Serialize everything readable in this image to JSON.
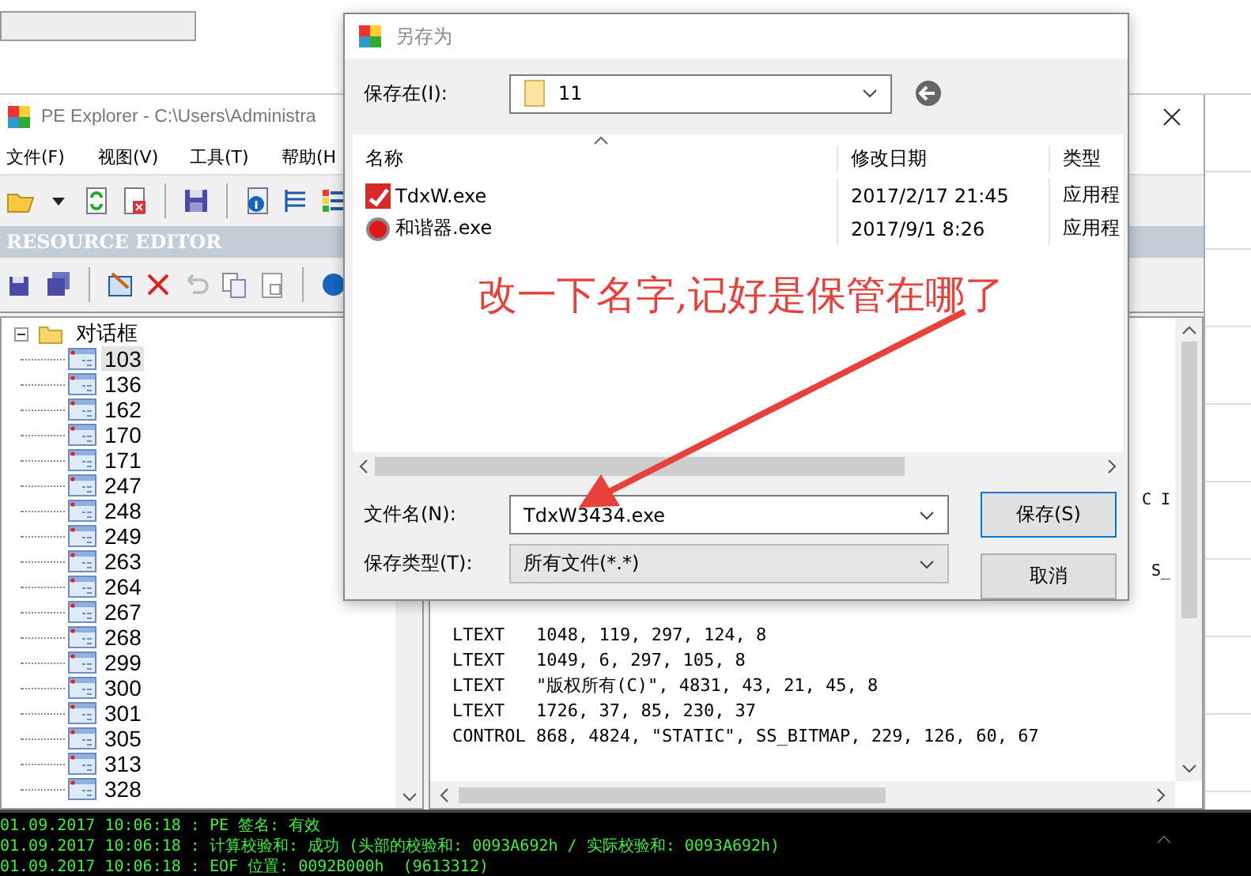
{
  "main_window": {
    "title": "PE Explorer - C:\\Users\\Administra",
    "menu": [
      "文件(F)",
      "视图(V)",
      "工具(T)",
      "帮助(H"
    ],
    "panel_title": "RESOURCE EDITOR",
    "tree": {
      "label": "对话框",
      "expanded": true,
      "children": [
        {
          "label": "103",
          "selected": true
        },
        {
          "label": "136",
          "selected": false
        },
        {
          "label": "162",
          "selected": false
        },
        {
          "label": "170",
          "selected": false
        },
        {
          "label": "171",
          "selected": false
        },
        {
          "label": "247",
          "selected": false
        },
        {
          "label": "248",
          "selected": false
        },
        {
          "label": "249",
          "selected": false
        },
        {
          "label": "263",
          "selected": false
        },
        {
          "label": "264",
          "selected": false
        },
        {
          "label": "267",
          "selected": false
        },
        {
          "label": "268",
          "selected": false
        },
        {
          "label": "299",
          "selected": false
        },
        {
          "label": "300",
          "selected": false
        },
        {
          "label": "301",
          "selected": false
        },
        {
          "label": "305",
          "selected": false
        },
        {
          "label": "313",
          "selected": false
        },
        {
          "label": "328",
          "selected": false
        }
      ]
    },
    "code_lines": [
      "LTEXT   1048, 119, 297, 124, 8",
      "LTEXT   1049, 6, 297, 105, 8",
      "LTEXT   \"版权所有(C)\", 4831, 43, 21, 45, 8",
      "LTEXT   1726, 37, 85, 230, 37",
      "CONTROL 868, 4824, \"STATIC\", SS_BITMAP, 229, 126, 60, 67"
    ],
    "code_fragments": [
      "C I",
      "S_"
    ],
    "log": [
      "01.09.2017 10:06:18 : PE 签名: 有效",
      "01.09.2017 10:06:18 : 计算校验和: 成功 (头部的校验和: 0093A692h / 实际校验和: 0093A692h)",
      "01.09.2017 10:06:18 : EOF 位置: 0092B000h  (9613312)"
    ]
  },
  "dialog": {
    "title": "另存为",
    "save_in_label": "保存在(I):",
    "folder": "11",
    "columns": [
      "名称",
      "修改日期",
      "类型"
    ],
    "files": [
      {
        "name": "TdxW.exe",
        "kind": "app",
        "date": "2017/2/17 21:45",
        "type": "应用程"
      },
      {
        "name": "和谐器.exe",
        "kind": "round",
        "date": "2017/9/1 8:26",
        "type": "应用程"
      }
    ],
    "filename_label": "文件名(N):",
    "filename": "TdxW3434.exe",
    "filetype_label": "保存类型(T):",
    "filetype": "所有文件(*.*)",
    "buttons": [
      "保存(S)",
      "取消"
    ]
  },
  "annotation": {
    "text": "改一下名字,记好是保管在哪了"
  }
}
